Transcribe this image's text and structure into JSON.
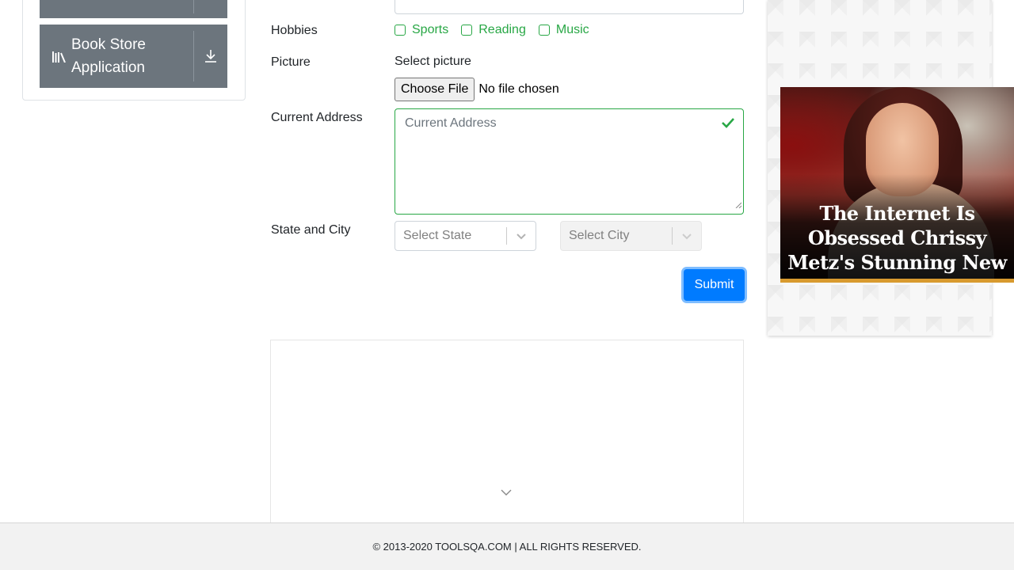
{
  "sidebar": {
    "book_store_label": "Book Store Application",
    "book_icon": "book-icon",
    "download_icon": "download-arrow-icon"
  },
  "form": {
    "hobbies_label": "Hobbies",
    "hobbies": [
      {
        "label": "Sports",
        "checked": false
      },
      {
        "label": "Reading",
        "checked": false
      },
      {
        "label": "Music",
        "checked": false
      }
    ],
    "picture_label": "Picture",
    "picture_hint": "Select picture",
    "choose_file_label": "Choose File",
    "file_status": "No file chosen",
    "address_label": "Current Address",
    "address_placeholder": "Current Address",
    "state_city_label": "State and City",
    "state_placeholder": "Select State",
    "city_placeholder": "Select City",
    "submit_label": "Submit"
  },
  "advertisement": {
    "headline": "The Internet Is Obsessed Chrissy Metz's Stunning New Figure"
  },
  "footer": {
    "copyright": "© 2013-2020 TOOLSQA.COM | ALL RIGHTS RESERVED."
  },
  "colors": {
    "valid_green": "#28a745",
    "primary_blue": "#007bff",
    "sidebar_gray": "#6c757d",
    "ad_accent": "#d89a2f"
  }
}
